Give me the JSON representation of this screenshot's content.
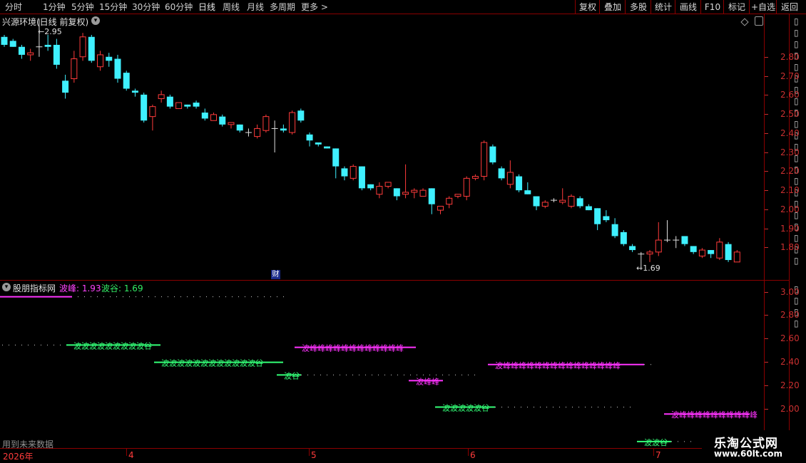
{
  "toolbar": {
    "periods": [
      "分时",
      "1分钟",
      "5分钟",
      "15分钟",
      "30分钟",
      "60分钟",
      "日线",
      "周线",
      "月线",
      "多周期",
      "更多"
    ],
    "active_period": "日线",
    "more_arrow": ">",
    "right_buttons": [
      "复权",
      "叠加",
      "多股",
      "统计",
      "画线",
      "F10",
      "标记",
      "+自选",
      "返回"
    ]
  },
  "chart": {
    "title": "兴源环境(日线 前复权)",
    "y_ticks": [
      "2.80",
      "2.70",
      "2.60",
      "2.50",
      "2.40",
      "2.30",
      "2.20",
      "2.10",
      "2.00",
      "1.90",
      "1.80"
    ],
    "high_label": "2.95",
    "low_label": "1.69",
    "finance_marker": "财",
    "colors": {
      "up": "#ff3b3b",
      "down": "#3ff0ff",
      "doji": "#e0e0e0"
    }
  },
  "chart_data": {
    "type": "candlestick",
    "ylim": [
      1.64,
      2.97
    ],
    "candles": [
      {
        "o": 2.86,
        "h": 2.87,
        "l": 2.81,
        "c": 2.82
      },
      {
        "o": 2.84,
        "h": 2.85,
        "l": 2.81,
        "c": 2.81
      },
      {
        "o": 2.81,
        "h": 2.82,
        "l": 2.75,
        "c": 2.77
      },
      {
        "o": 2.77,
        "h": 2.8,
        "l": 2.74,
        "c": 2.78
      },
      {
        "o": 2.81,
        "h": 2.95,
        "l": 2.76,
        "c": 2.81
      },
      {
        "o": 2.82,
        "h": 2.87,
        "l": 2.79,
        "c": 2.81
      },
      {
        "o": 2.82,
        "h": 2.85,
        "l": 2.7,
        "c": 2.72
      },
      {
        "o": 2.64,
        "h": 2.67,
        "l": 2.55,
        "c": 2.58
      },
      {
        "o": 2.65,
        "h": 2.79,
        "l": 2.63,
        "c": 2.75
      },
      {
        "o": 2.76,
        "h": 2.88,
        "l": 2.74,
        "c": 2.86
      },
      {
        "o": 2.86,
        "h": 2.87,
        "l": 2.73,
        "c": 2.74
      },
      {
        "o": 2.71,
        "h": 2.79,
        "l": 2.69,
        "c": 2.77
      },
      {
        "o": 2.76,
        "h": 2.78,
        "l": 2.71,
        "c": 2.74
      },
      {
        "o": 2.75,
        "h": 2.77,
        "l": 2.63,
        "c": 2.65
      },
      {
        "o": 2.68,
        "h": 2.69,
        "l": 2.59,
        "c": 2.6
      },
      {
        "o": 2.59,
        "h": 2.6,
        "l": 2.56,
        "c": 2.58
      },
      {
        "o": 2.57,
        "h": 2.58,
        "l": 2.43,
        "c": 2.44
      },
      {
        "o": 2.46,
        "h": 2.52,
        "l": 2.39,
        "c": 2.51
      },
      {
        "o": 2.55,
        "h": 2.59,
        "l": 2.53,
        "c": 2.57
      },
      {
        "o": 2.56,
        "h": 2.57,
        "l": 2.5,
        "c": 2.51
      },
      {
        "o": 2.5,
        "h": 2.53,
        "l": 2.5,
        "c": 2.53
      },
      {
        "o": 2.52,
        "h": 2.52,
        "l": 2.5,
        "c": 2.51
      },
      {
        "o": 2.53,
        "h": 2.54,
        "l": 2.5,
        "c": 2.51
      },
      {
        "o": 2.48,
        "h": 2.5,
        "l": 2.44,
        "c": 2.45
      },
      {
        "o": 2.44,
        "h": 2.48,
        "l": 2.44,
        "c": 2.47
      },
      {
        "o": 2.46,
        "h": 2.47,
        "l": 2.41,
        "c": 2.42
      },
      {
        "o": 2.42,
        "h": 2.43,
        "l": 2.4,
        "c": 2.43
      },
      {
        "o": 2.42,
        "h": 2.42,
        "l": 2.38,
        "c": 2.39
      },
      {
        "o": 2.38,
        "h": 2.4,
        "l": 2.36,
        "c": 2.38
      },
      {
        "o": 2.36,
        "h": 2.42,
        "l": 2.35,
        "c": 2.4
      },
      {
        "o": 2.39,
        "h": 2.47,
        "l": 2.38,
        "c": 2.46
      },
      {
        "o": 2.4,
        "h": 2.44,
        "l": 2.28,
        "c": 2.4
      },
      {
        "o": 2.4,
        "h": 2.42,
        "l": 2.38,
        "c": 2.39
      },
      {
        "o": 2.38,
        "h": 2.49,
        "l": 2.37,
        "c": 2.48
      },
      {
        "o": 2.49,
        "h": 2.5,
        "l": 2.43,
        "c": 2.44
      },
      {
        "o": 2.37,
        "h": 2.38,
        "l": 2.31,
        "c": 2.34
      },
      {
        "o": 2.33,
        "h": 2.33,
        "l": 2.31,
        "c": 2.32
      },
      {
        "o": 2.31,
        "h": 2.31,
        "l": 2.3,
        "c": 2.3
      },
      {
        "o": 2.3,
        "h": 2.3,
        "l": 2.15,
        "c": 2.21
      },
      {
        "o": 2.2,
        "h": 2.21,
        "l": 2.14,
        "c": 2.16
      },
      {
        "o": 2.15,
        "h": 2.22,
        "l": 2.14,
        "c": 2.21
      },
      {
        "o": 2.21,
        "h": 2.21,
        "l": 2.09,
        "c": 2.1
      },
      {
        "o": 2.12,
        "h": 2.12,
        "l": 2.09,
        "c": 2.1
      },
      {
        "o": 2.07,
        "h": 2.13,
        "l": 2.05,
        "c": 2.11
      },
      {
        "o": 2.11,
        "h": 2.13,
        "l": 2.1,
        "c": 2.13
      },
      {
        "o": 2.1,
        "h": 2.1,
        "l": 2.04,
        "c": 2.06
      },
      {
        "o": 2.07,
        "h": 2.22,
        "l": 2.05,
        "c": 2.08
      },
      {
        "o": 2.08,
        "h": 2.1,
        "l": 2.05,
        "c": 2.09
      },
      {
        "o": 2.06,
        "h": 2.1,
        "l": 2.06,
        "c": 2.09
      },
      {
        "o": 2.1,
        "h": 2.1,
        "l": 1.97,
        "c": 2.02
      },
      {
        "o": 1.99,
        "h": 2.01,
        "l": 1.97,
        "c": 2.01
      },
      {
        "o": 2.02,
        "h": 2.06,
        "l": 2.0,
        "c": 2.05
      },
      {
        "o": 2.06,
        "h": 2.07,
        "l": 2.05,
        "c": 2.07
      },
      {
        "o": 2.06,
        "h": 2.16,
        "l": 2.04,
        "c": 2.15
      },
      {
        "o": 2.15,
        "h": 2.17,
        "l": 2.14,
        "c": 2.16
      },
      {
        "o": 2.16,
        "h": 2.34,
        "l": 2.14,
        "c": 2.33
      },
      {
        "o": 2.31,
        "h": 2.32,
        "l": 2.22,
        "c": 2.23
      },
      {
        "o": 2.2,
        "h": 2.21,
        "l": 2.14,
        "c": 2.15
      },
      {
        "o": 2.12,
        "h": 2.24,
        "l": 2.1,
        "c": 2.18
      },
      {
        "o": 2.16,
        "h": 2.17,
        "l": 2.08,
        "c": 2.09
      },
      {
        "o": 2.09,
        "h": 2.13,
        "l": 2.07,
        "c": 2.07
      },
      {
        "o": 2.06,
        "h": 2.06,
        "l": 1.99,
        "c": 2.01
      },
      {
        "o": 2.01,
        "h": 2.04,
        "l": 2.0,
        "c": 2.03
      },
      {
        "o": 2.04,
        "h": 2.05,
        "l": 2.03,
        "c": 2.04
      },
      {
        "o": 2.03,
        "h": 2.1,
        "l": 2.02,
        "c": 2.04
      },
      {
        "o": 2.01,
        "h": 2.07,
        "l": 2.0,
        "c": 2.06
      },
      {
        "o": 2.05,
        "h": 2.06,
        "l": 2.0,
        "c": 2.01
      },
      {
        "o": 2.01,
        "h": 2.02,
        "l": 1.99,
        "c": 1.99
      },
      {
        "o": 2.0,
        "h": 2.0,
        "l": 1.89,
        "c": 1.92
      },
      {
        "o": 1.96,
        "h": 1.99,
        "l": 1.93,
        "c": 1.94
      },
      {
        "o": 1.92,
        "h": 1.95,
        "l": 1.85,
        "c": 1.86
      },
      {
        "o": 1.88,
        "h": 1.89,
        "l": 1.81,
        "c": 1.82
      },
      {
        "o": 1.81,
        "h": 1.82,
        "l": 1.78,
        "c": 1.79
      },
      {
        "o": 1.77,
        "h": 1.78,
        "l": 1.69,
        "c": 1.77
      },
      {
        "o": 1.77,
        "h": 1.79,
        "l": 1.73,
        "c": 1.78
      },
      {
        "o": 1.78,
        "h": 1.93,
        "l": 1.76,
        "c": 1.84
      },
      {
        "o": 1.84,
        "h": 1.94,
        "l": 1.83,
        "c": 1.84
      },
      {
        "o": 1.84,
        "h": 1.86,
        "l": 1.8,
        "c": 1.84
      },
      {
        "o": 1.86,
        "h": 1.86,
        "l": 1.81,
        "c": 1.82
      },
      {
        "o": 1.81,
        "h": 1.81,
        "l": 1.77,
        "c": 1.78
      },
      {
        "o": 1.76,
        "h": 1.8,
        "l": 1.75,
        "c": 1.79
      },
      {
        "o": 1.79,
        "h": 1.79,
        "l": 1.75,
        "c": 1.77
      },
      {
        "o": 1.75,
        "h": 1.85,
        "l": 1.74,
        "c": 1.83
      },
      {
        "o": 1.82,
        "h": 1.83,
        "l": 1.73,
        "c": 1.74
      },
      {
        "o": 1.73,
        "h": 1.79,
        "l": 1.73,
        "c": 1.78
      }
    ]
  },
  "indicator": {
    "name": "股朋指标网",
    "peak_label": "波峰: 1.93",
    "trough_label": "波谷: 1.69",
    "y_ticks": [
      "3.00",
      "2.80",
      "2.60",
      "2.40",
      "2.20",
      "2.00"
    ],
    "future_data_note": "用到未来数据",
    "colors": {
      "peak": "#ff33ff",
      "trough": "#33ff77"
    },
    "ylim": [
      1.64,
      3.09
    ],
    "levels": [
      {
        "kind": "peak",
        "value": 2.95,
        "x0": 0,
        "x1": 101,
        "text": ""
      },
      {
        "kind": "trough",
        "value": 2.53,
        "x0": 93,
        "x1": 225,
        "text": "波波波波波波波波波谷"
      },
      {
        "kind": "trough",
        "value": 2.38,
        "x0": 216,
        "x1": 397,
        "text": "波波波波波波波波波波波波谷"
      },
      {
        "kind": "trough",
        "value": 2.27,
        "x0": 388,
        "x1": 422,
        "text": "波谷"
      },
      {
        "kind": "peak",
        "value": 2.51,
        "x0": 413,
        "x1": 583,
        "text": "波峰峰峰峰峰峰峰峰峰峰峰峰"
      },
      {
        "kind": "peak",
        "value": 2.22,
        "x0": 573,
        "x1": 621,
        "text": "波峰峰"
      },
      {
        "kind": "trough",
        "value": 1.99,
        "x0": 610,
        "x1": 694,
        "text": "波波波波波谷"
      },
      {
        "kind": "peak",
        "value": 2.36,
        "x0": 684,
        "x1": 903,
        "text": "波峰峰峰峰峰峰峰峰峰峰峰峰峰峰峰"
      },
      {
        "kind": "trough",
        "value": 1.69,
        "x0": 893,
        "x1": 941,
        "text": "波波谷"
      },
      {
        "kind": "peak",
        "value": 1.93,
        "x0": 931,
        "x1": 1051,
        "text": "波峰峰峰峰峰峰峰峰峰峰"
      }
    ],
    "dotted_lines": [
      {
        "value": 2.95,
        "x0": 100,
        "x1": 405,
        "color": "#d0d0d0"
      },
      {
        "value": 2.53,
        "x0": 3,
        "x1": 92,
        "color": "#d0d0d0"
      },
      {
        "value": 2.27,
        "x0": 422,
        "x1": 672,
        "color": "#d0d0d0"
      },
      {
        "value": 1.99,
        "x0": 694,
        "x1": 884,
        "color": "#d0d0d0"
      },
      {
        "value": 2.36,
        "x0": 903,
        "x1": 921,
        "color": "#d0d0d0"
      },
      {
        "value": 1.69,
        "x0": 941,
        "x1": 976,
        "color": "#d0d0d0"
      }
    ]
  },
  "date_axis": {
    "labels": [
      {
        "text": "2026年",
        "color": "#ff3b3b"
      },
      {
        "text": "4",
        "color": "#ff3b3b"
      },
      {
        "text": "5",
        "color": "#ff3b3b"
      },
      {
        "text": "6",
        "color": "#ff3b3b"
      },
      {
        "text": "7",
        "color": "#ff3b3b"
      }
    ]
  },
  "watermark": {
    "line1": "乐淘公式网",
    "line2": "www.60lt.com"
  }
}
